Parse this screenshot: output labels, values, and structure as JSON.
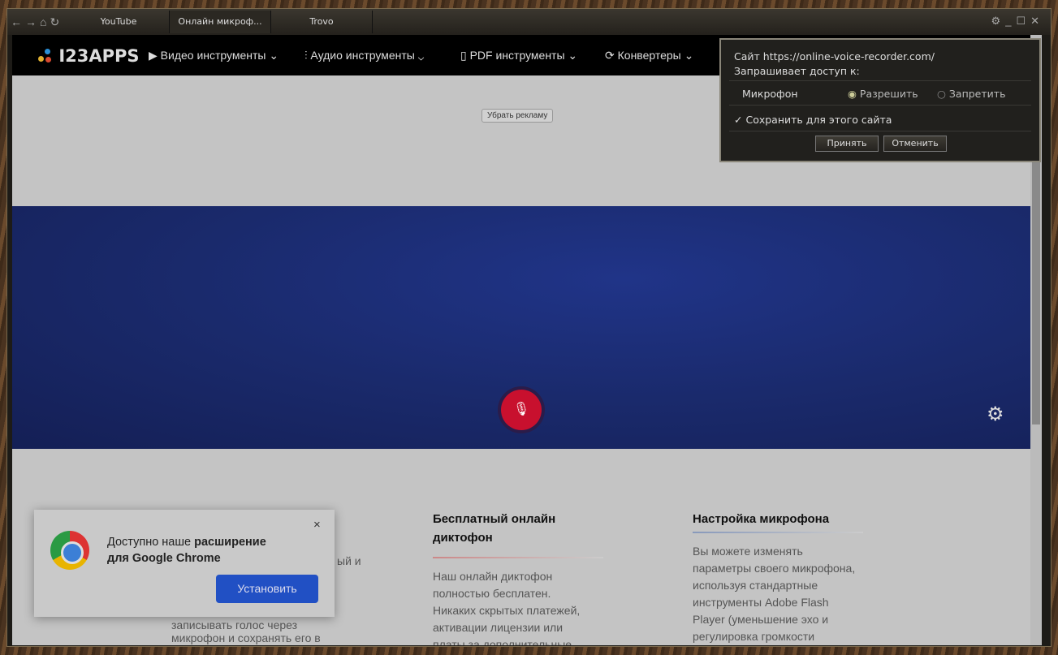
{
  "browser": {
    "tabs": [
      "YouTube",
      "Онлайн микроф...",
      "Trovo"
    ],
    "controls": [
      "back-icon",
      "forward-icon",
      "home-icon",
      "reload-icon"
    ]
  },
  "site": {
    "logo": "I23APPS",
    "nav": [
      "Видео инструменты",
      "Аудио инструменты",
      "PDF инструменты",
      "Конвертеры"
    ],
    "remove_ads": "Убрать рекламу"
  },
  "colors": {
    "banner": "#1a2a6c",
    "mic": "#c8102e",
    "install": "#2150c4"
  },
  "columns": [
    {
      "title": "",
      "text": [
        "ый и",
        "",
        "",
        "записывать голос через",
        "микрофон и сохранять его в"
      ]
    },
    {
      "title": "Бесплатный онлайн диктофон",
      "text": [
        "Наш онлайн диктофон",
        "полностью бесплатен.",
        "Никаких скрытых платежей,",
        "активации лицензии или",
        "платы за дополнительные"
      ]
    },
    {
      "title": "Настройка микрофона",
      "text": [
        "Вы можете изменять",
        "параметры своего микрофона,",
        "используя стандартные",
        "инструменты Adobe Flash",
        "Player (уменьшение эхо и",
        "регулировка громкости"
      ]
    }
  ],
  "popup": {
    "text_plain": "Доступно наше ",
    "text_bold1": "расширение",
    "text_bold2": "для Google Chrome",
    "install": "Установить",
    "close": "×"
  },
  "dialog": {
    "line1": "Сайт https://online-voice-recorder.com/",
    "line2": "Запрашивает доступ к:",
    "device": "Микрофон",
    "allow": "Разрешить",
    "deny": "Запретить",
    "selected": "allow",
    "remember": "Сохранить для этого сайта",
    "remember_checked": true,
    "accept": "Принять",
    "cancel": "Отменить"
  }
}
